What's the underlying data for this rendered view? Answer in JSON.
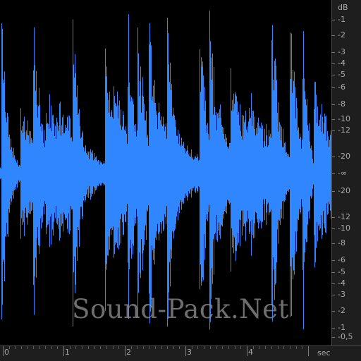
{
  "colors": {
    "waveform": "#2f86ff",
    "background": "#000000",
    "ruler_bg": "#1e1e1e",
    "ruler_text": "#a8a8a8"
  },
  "db_ruler": {
    "unit": "dB",
    "upper_labels": [
      "-1",
      "-2",
      "-3",
      "-4",
      "-5",
      "-6",
      "-8",
      "-10",
      "-12",
      "-20"
    ],
    "center_label": "-∞",
    "lower_labels": [
      "-20",
      "-12",
      "-10",
      "-8",
      "-6",
      "-5",
      "-4",
      "-3",
      "-2",
      "-1",
      "-0,5"
    ]
  },
  "time_ruler": {
    "unit": "sec",
    "labels": [
      "0",
      "1",
      "2",
      "3",
      "4"
    ]
  },
  "watermark": "Sound-Pack.Net"
}
